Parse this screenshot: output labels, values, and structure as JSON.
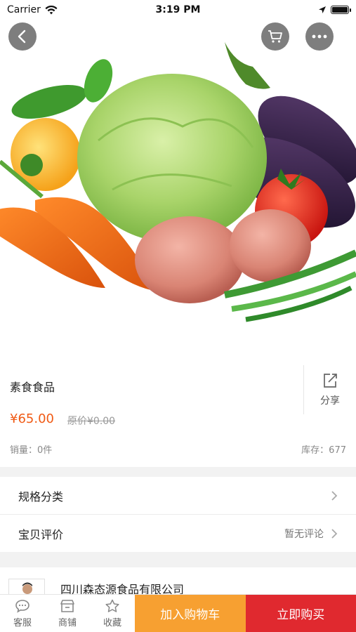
{
  "status_bar": {
    "carrier": "Carrier",
    "time": "3:19 PM"
  },
  "product": {
    "name": "素食食品",
    "price": "¥65.00",
    "original_price": "原价¥0.00",
    "sales": "销量：0件",
    "stock": "库存：677",
    "share_label": "分享"
  },
  "rows": {
    "spec_label": "规格分类",
    "reviews_label": "宝贝评价",
    "reviews_note": "暂无评论"
  },
  "shop": {
    "name": "四川森态源食品有限公司"
  },
  "bottom_bar": {
    "service_label": "客服",
    "store_label": "商铺",
    "favorite_label": "收藏",
    "add_cart_label": "加入购物车",
    "buy_now_label": "立即购买"
  },
  "colors": {
    "price": "#f05a14",
    "add_cart": "#f7a031",
    "buy_now": "#e0292f",
    "nav_button": "#5a5a5a"
  },
  "icons": [
    "chevron-left-icon",
    "cart-icon",
    "more-icon",
    "share-icon",
    "chevron-right-icon",
    "chat-icon",
    "store-icon",
    "star-icon",
    "wifi-icon",
    "location-icon",
    "battery-icon"
  ]
}
